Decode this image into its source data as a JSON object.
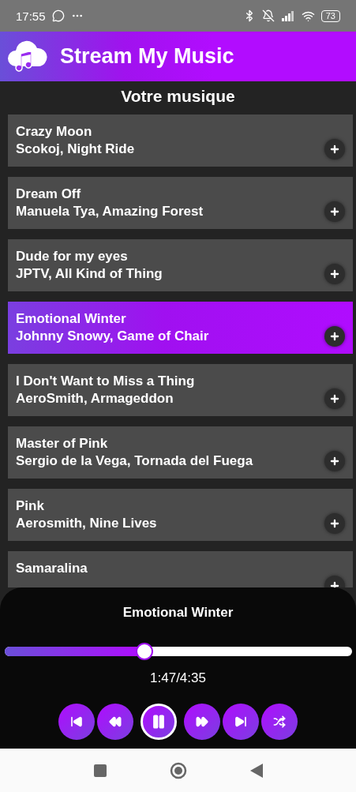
{
  "status_bar": {
    "time": "17:55",
    "battery": "73"
  },
  "app_bar": {
    "title": "Stream My Music"
  },
  "section_title": "Votre musique",
  "songs": [
    {
      "title": "Crazy Moon",
      "artist": "Scokoj, Night Ride",
      "selected": false
    },
    {
      "title": "Dream Off",
      "artist": "Manuela Tya, Amazing Forest",
      "selected": false
    },
    {
      "title": "Dude for my eyes",
      "artist": "JPTV, All Kind of Thing",
      "selected": false
    },
    {
      "title": "Emotional Winter",
      "artist": "Johnny Snowy, Game of Chair",
      "selected": true
    },
    {
      "title": "I Don't Want to Miss a Thing",
      "artist": "AeroSmith, Armageddon",
      "selected": false
    },
    {
      "title": "Master of Pink",
      "artist": "Sergio de la Vega, Tornada del Fuega",
      "selected": false
    },
    {
      "title": "Pink",
      "artist": "Aerosmith, Nine Lives",
      "selected": false
    },
    {
      "title": "Samaralina",
      "selected": false
    }
  ],
  "player": {
    "title": "Emotional Winter",
    "level": 0.4,
    "time": "1:47/4:35",
    "playing": true,
    "controls": [
      {
        "kind": "skip-back"
      },
      {
        "kind": "rewind"
      },
      {
        "kind": "play"
      },
      {
        "kind": "forward"
      },
      {
        "kind": "skip-forward"
      },
      {
        "kind": "shuffle"
      }
    ]
  }
}
